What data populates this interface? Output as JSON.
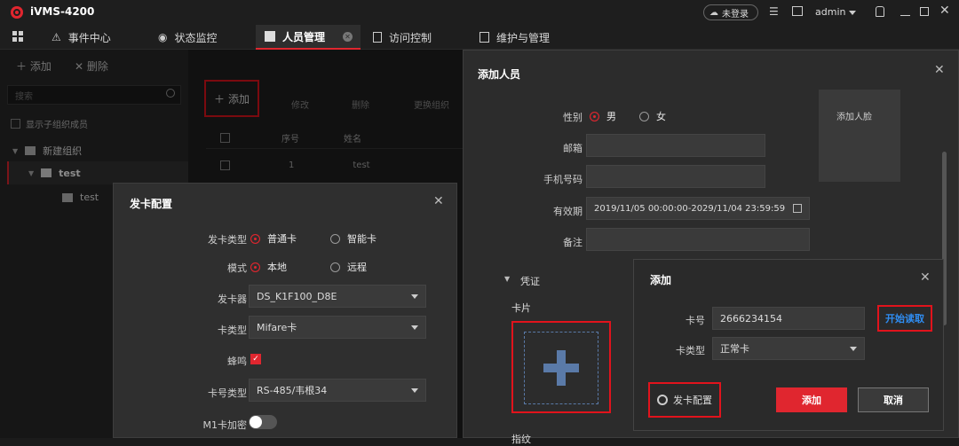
{
  "app": {
    "title": "iVMS-4200",
    "login": "未登录",
    "user": "admin"
  },
  "menu": {
    "tabs": [
      {
        "label": "事件中心"
      },
      {
        "label": "状态监控"
      },
      {
        "label": "人员管理"
      },
      {
        "label": "访问控制"
      },
      {
        "label": "维护与管理"
      }
    ]
  },
  "sidebar": {
    "add": "添加",
    "delete": "删除",
    "search_placeholder": "搜索",
    "show_sub": "显示子组织成员",
    "tree": [
      {
        "label": "新建组织"
      },
      {
        "label": "test"
      },
      {
        "label": "test"
      }
    ]
  },
  "toolbar": {
    "add": "添加",
    "modify": "修改",
    "delete": "删除",
    "change_org": "更换组织"
  },
  "table": {
    "headers": [
      "序号",
      "姓名"
    ],
    "rows": [
      {
        "no": "1",
        "name": "test"
      }
    ]
  },
  "card_config": {
    "title": "发卡配置",
    "card_type_label": "发卡类型",
    "card_type_opts": [
      "普通卡",
      "智能卡"
    ],
    "mode_label": "模式",
    "mode_opts": [
      "本地",
      "远程"
    ],
    "issuer_label": "发卡器",
    "issuer_value": "DS_K1F100_D8E",
    "cardtype_label": "卡类型",
    "cardtype_value": "Mifare卡",
    "beep_label": "蜂鸣",
    "cardno_type_label": "卡号类型",
    "cardno_type_value": "RS-485/韦根34",
    "m1_label": "M1卡加密"
  },
  "add_person": {
    "title": "添加人员",
    "gender_label": "性别",
    "gender_opts": [
      "男",
      "女"
    ],
    "email_label": "邮箱",
    "phone_label": "手机号码",
    "valid_label": "有效期",
    "valid_value": "2019/11/05 00:00:00-2029/11/04 23:59:59",
    "remark_label": "备注",
    "add_face": "添加人脸",
    "credential": "凭证",
    "card": "卡片",
    "fingerprint": "指纹"
  },
  "add_card": {
    "title": "添加",
    "cardno_label": "卡号",
    "cardno_value": "2666234154",
    "start_read": "开始读取",
    "cardtype_label": "卡类型",
    "cardtype_value": "正常卡",
    "config_btn": "发卡配置",
    "add_btn": "添加",
    "cancel_btn": "取消"
  },
  "colors": {
    "accent": "#e0262f",
    "link": "#2f8cf0"
  }
}
